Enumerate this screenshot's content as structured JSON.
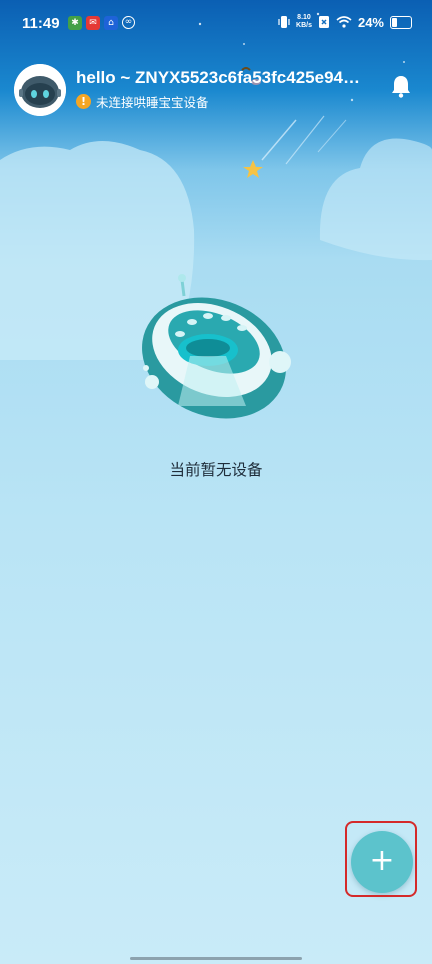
{
  "status_bar": {
    "time": "11:49",
    "net_speed_value": "8.10",
    "net_speed_unit": "KB/s",
    "battery": "24%"
  },
  "header": {
    "greeting": "hello ~ ZNYX5523c6fa53fc425e94…",
    "device_status": "未连接哄睡宝宝设备",
    "warning_glyph": "!"
  },
  "empty_state": {
    "message": "当前暂无设备"
  },
  "fab": {
    "label": "+"
  },
  "colors": {
    "accent": "#5cc3cc",
    "warning": "#f5a623",
    "highlight": "#d42a2a"
  }
}
